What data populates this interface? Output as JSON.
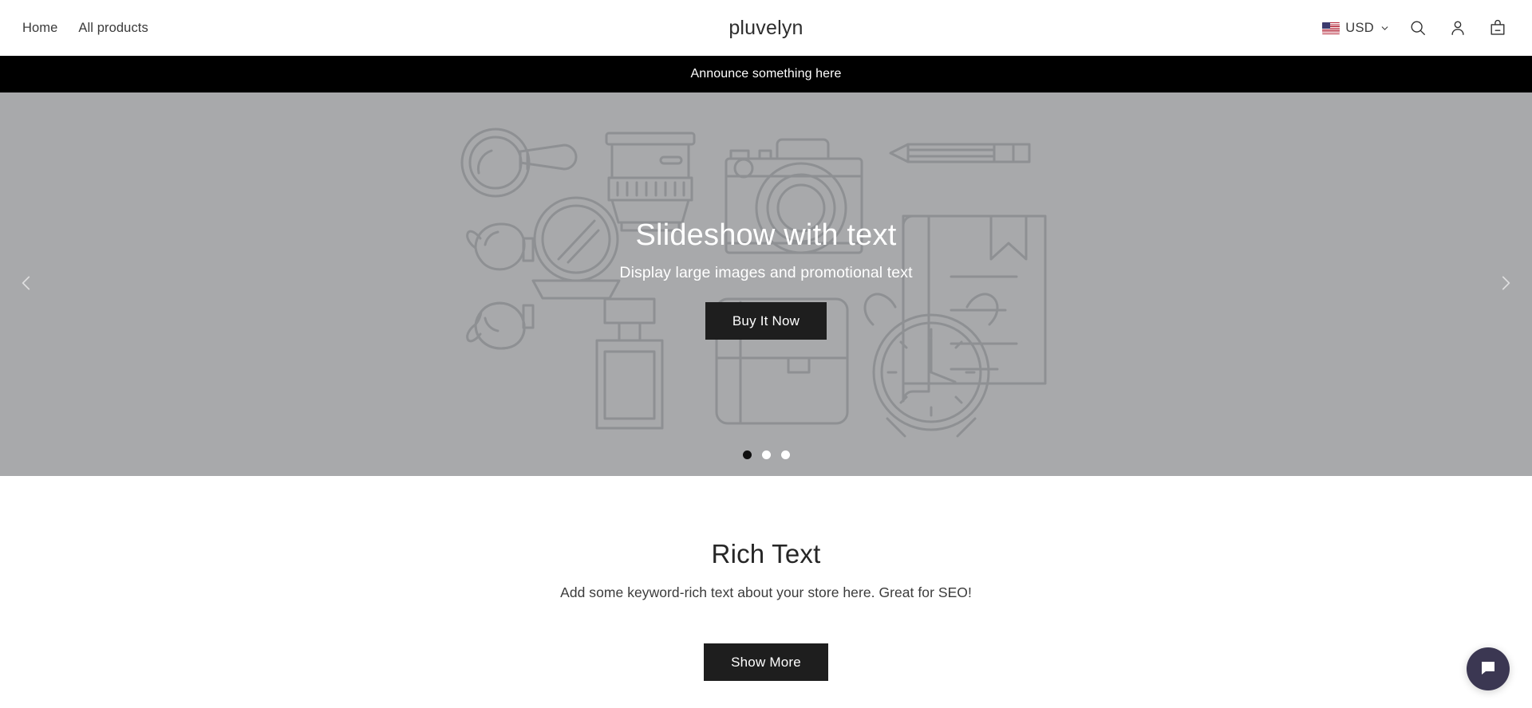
{
  "header": {
    "nav_links": [
      {
        "label": "Home",
        "name": "nav-link-home"
      },
      {
        "label": "All products",
        "name": "nav-link-all-products"
      }
    ],
    "logo": "pluvelyn",
    "currency": {
      "label": "USD",
      "flag": "us-flag-icon",
      "chevron": "chevron-down-icon"
    },
    "icons": [
      {
        "name": "search-icon",
        "label": "Search"
      },
      {
        "name": "account-icon",
        "label": "Account"
      },
      {
        "name": "cart-icon",
        "label": "Cart"
      }
    ]
  },
  "announcement": {
    "text": "Announce something here",
    "background": "#000000",
    "color": "#ffffff"
  },
  "hero": {
    "background": "#a8a9ab",
    "title": "Slideshow with text",
    "subtitle": "Display large images and promotional text",
    "cta_label": "Buy It Now",
    "prev_icon": "chevron-left-icon",
    "next_icon": "chevron-right-icon",
    "slides": [
      {
        "index": 1,
        "active": true
      },
      {
        "index": 2,
        "active": false
      },
      {
        "index": 3,
        "active": false
      }
    ],
    "illustration_items": [
      "magnifying-glass",
      "camera-lens",
      "camera",
      "pencil",
      "hand-mirror",
      "book-with-bookmark",
      "sunglasses",
      "perfume-bottle",
      "handbag",
      "alarm-clock"
    ]
  },
  "rich_text": {
    "title": "Rich Text",
    "body": "Add some keyword-rich text about your store here. Great for SEO!",
    "cta_label": "Show More"
  },
  "chat": {
    "icon": "chat-bubble-icon",
    "color": "#3b3752"
  }
}
